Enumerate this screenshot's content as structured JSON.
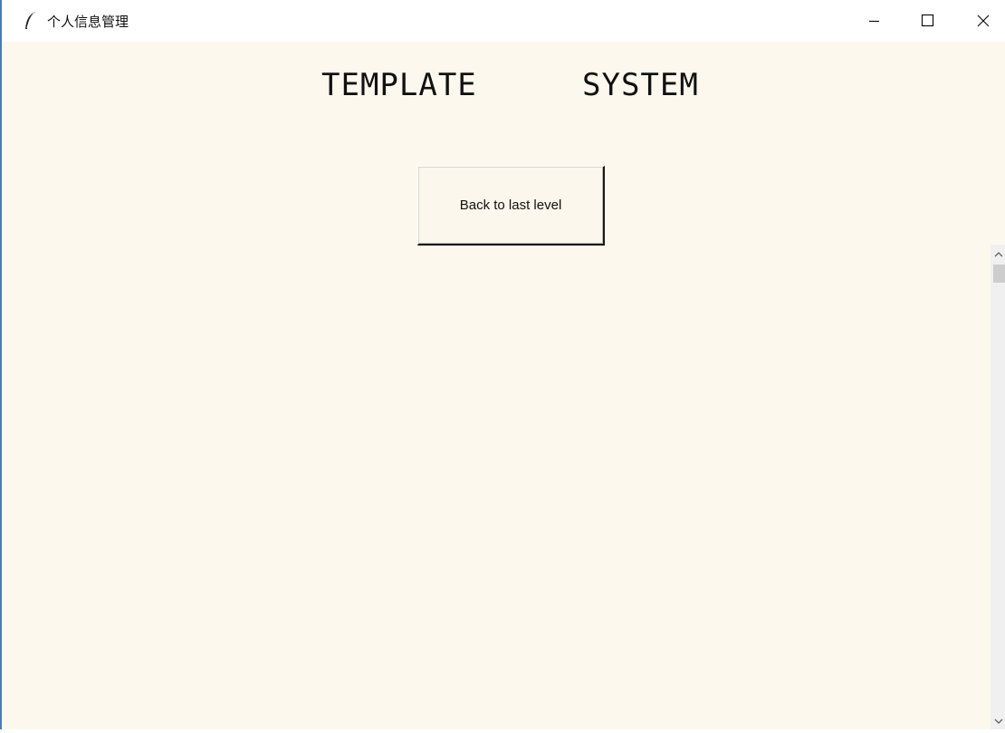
{
  "window": {
    "title": "个人信息管理",
    "controls": {
      "minimize": "minimize-icon",
      "maximize": "maximize-icon",
      "close": "close-icon"
    },
    "app_icon": "feather-icon"
  },
  "header": {
    "left_text": "TEMPLATE",
    "right_text": "SYSTEM"
  },
  "main": {
    "back_button_label": "Back to last level"
  },
  "colors": {
    "background": "#fdf8ee",
    "titlebar": "#ffffff",
    "text": "#111111"
  }
}
